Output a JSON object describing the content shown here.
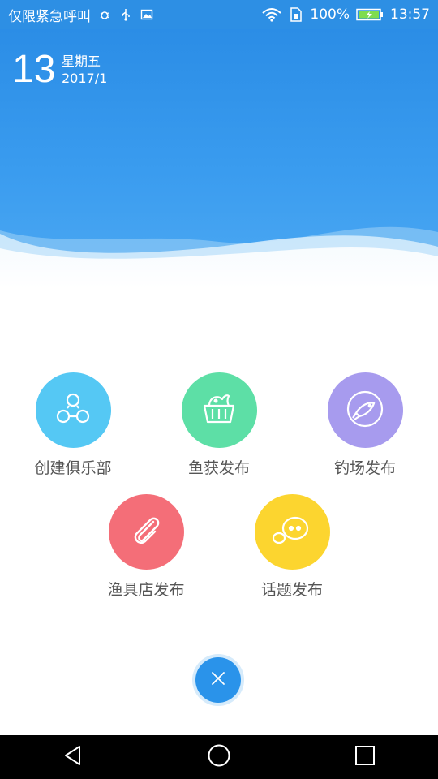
{
  "status_bar": {
    "emergency_text": "仅限紧急呼叫",
    "battery": "100%",
    "time": "13:57"
  },
  "date": {
    "day": "13",
    "weekday": "星期五",
    "year_month": "2017/1"
  },
  "actions": [
    {
      "label": "创建俱乐部",
      "color": "#55c8f4",
      "icon": "people-group-icon"
    },
    {
      "label": "鱼获发布",
      "color": "#5ddfa6",
      "icon": "basket-fish-icon"
    },
    {
      "label": "钓场发布",
      "color": "#a79bee",
      "icon": "fish-circle-icon"
    },
    {
      "label": "渔具店发布",
      "color": "#f46e78",
      "icon": "paperclip-icon"
    },
    {
      "label": "话题发布",
      "color": "#fcd52f",
      "icon": "chat-bubbles-icon"
    }
  ],
  "close_button": {
    "icon": "close-icon",
    "color": "#2a93ea"
  },
  "nav": {
    "back": "back-icon",
    "home": "home-icon",
    "recents": "recents-icon"
  }
}
